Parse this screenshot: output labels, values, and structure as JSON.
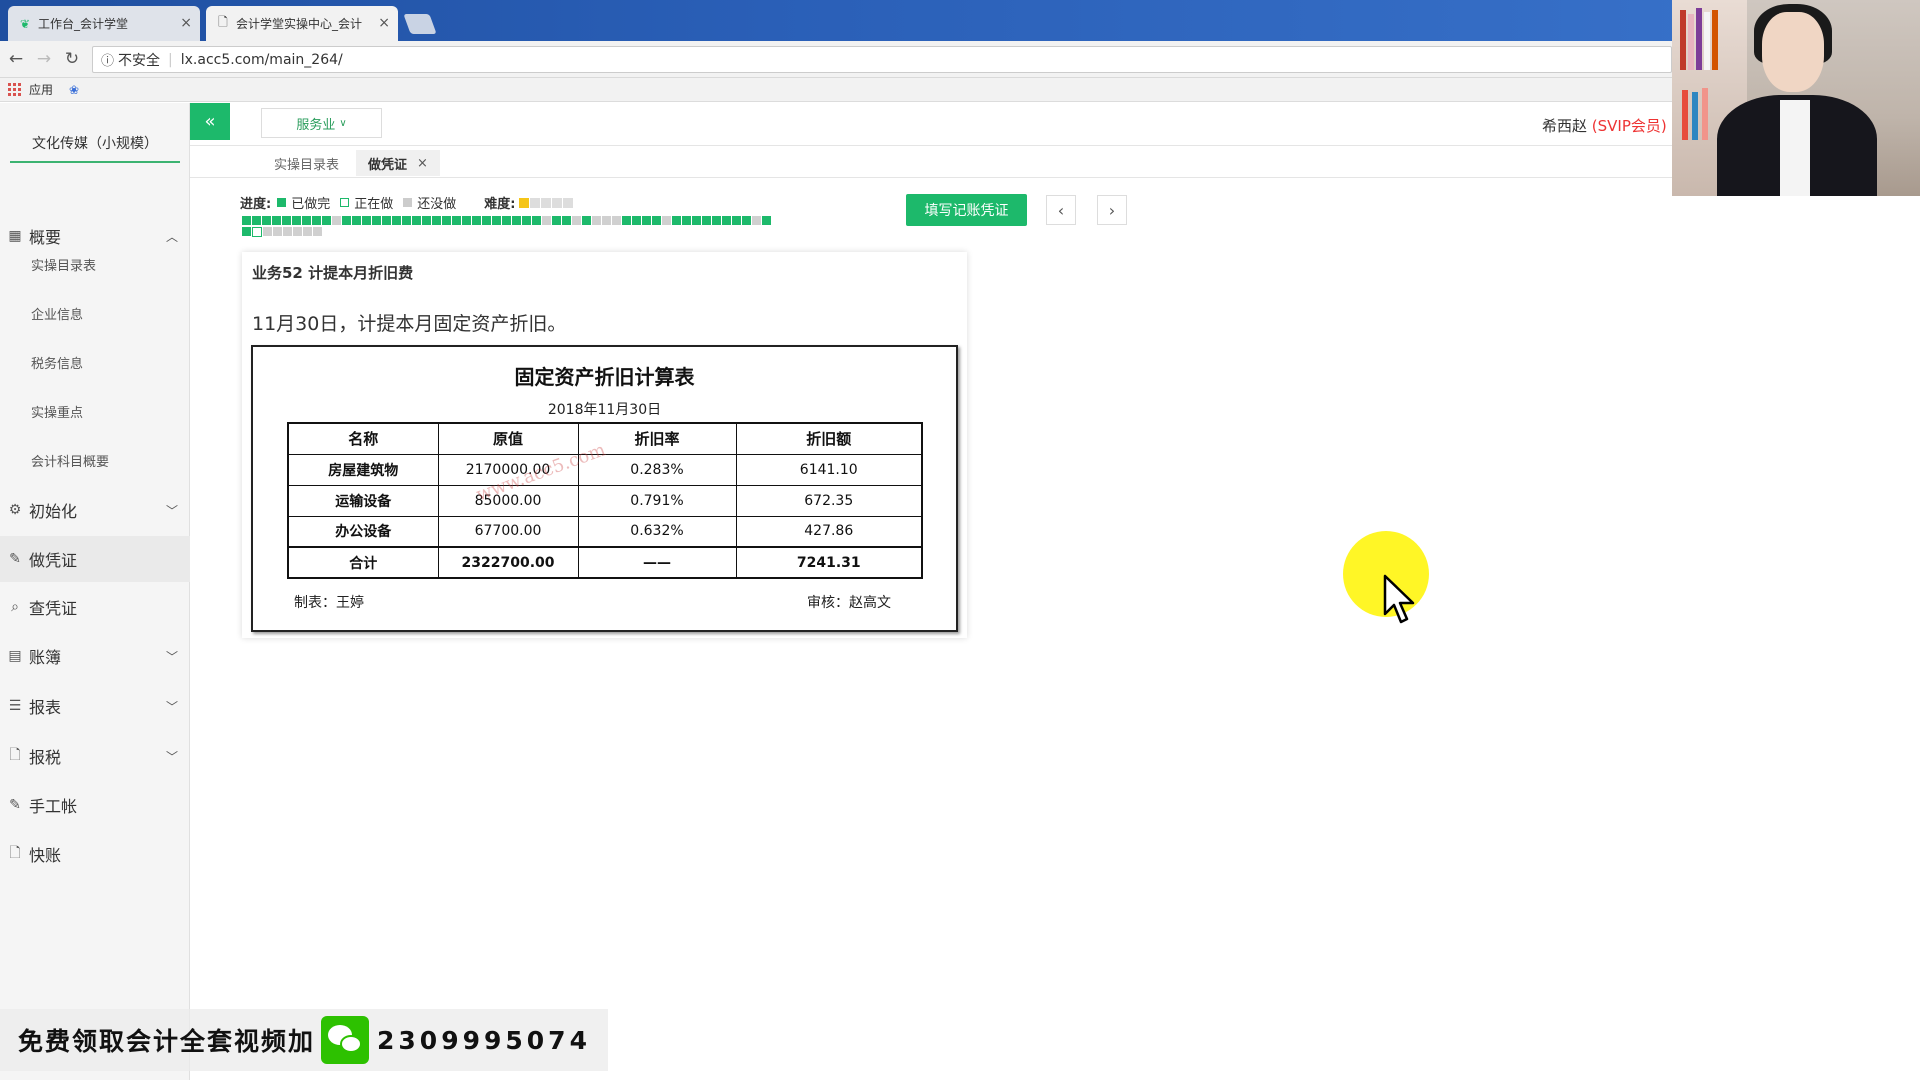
{
  "browser": {
    "tabs": [
      {
        "title": "工作台_会计学堂"
      },
      {
        "title": "会计学堂实操中心_会计"
      }
    ],
    "security_label": "不安全",
    "url": "lx.acc5.com/main_264/",
    "bookmarks_apps_label": "应用"
  },
  "sidebar": {
    "company": "文化传媒（小规模）",
    "overview": "概要",
    "sub_items": [
      "实操目录表",
      "企业信息",
      "税务信息",
      "实操重点",
      "会计科目概要"
    ],
    "init": "初始化",
    "make_voucher": "做凭证",
    "query_voucher": "查凭证",
    "ledger": "账簿",
    "reports": "报表",
    "tax": "报税",
    "manual": "手工帐",
    "quick": "快账"
  },
  "header": {
    "industry": "服务业",
    "username": "希西赵",
    "vip": "(SVIP会员)"
  },
  "content_tabs": {
    "catalog": "实操目录表",
    "voucher": "做凭证"
  },
  "progress": {
    "label": "进度:",
    "done": "已做完",
    "doing": "正在做",
    "todo": "还没做",
    "difficulty_label": "难度:",
    "difficulty_level": 1,
    "difficulty_max": 5
  },
  "actions": {
    "fill_voucher": "填写记账凭证",
    "prev": "‹",
    "next": "›"
  },
  "task": {
    "title": "业务52 计提本月折旧费",
    "description": "11月30日，计提本月固定资产折旧。"
  },
  "document": {
    "title": "固定资产折旧计算表",
    "date": "2018年11月30日",
    "headers": [
      "名称",
      "原值",
      "折旧率",
      "折旧额"
    ],
    "rows": [
      [
        "房屋建筑物",
        "2170000.00",
        "0.283%",
        "6141.10"
      ],
      [
        "运输设备",
        "85000.00",
        "0.791%",
        "672.35"
      ],
      [
        "办公设备",
        "67700.00",
        "0.632%",
        "427.86"
      ]
    ],
    "total": [
      "合计",
      "2322700.00",
      "——",
      "7241.31"
    ],
    "maker": "制表：王婷",
    "reviewer": "审核：赵高文",
    "watermark": "www.acc5.com"
  },
  "promo": {
    "text": "免费领取会计全套视频加",
    "number": "2309995074"
  },
  "colors": {
    "accent": "#1db96b",
    "vip": "#ee3333",
    "cursor_halo": "#fff500"
  }
}
